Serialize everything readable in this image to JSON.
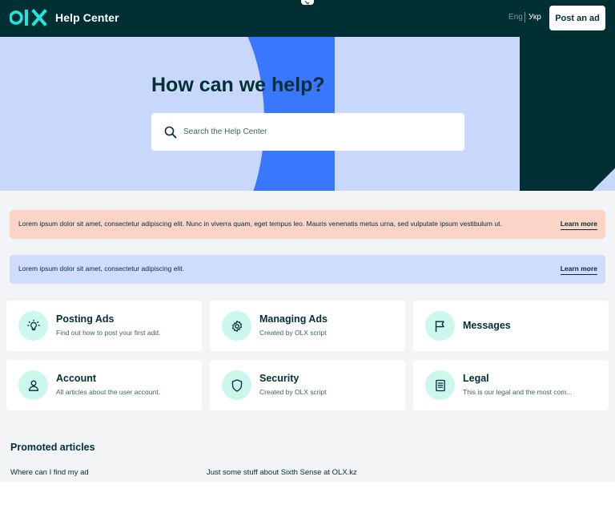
{
  "header": {
    "brand": "olx",
    "title": "Help Center",
    "lang_en": "Eng",
    "lang_uk": "Укр",
    "post_button": "Post an ad"
  },
  "colors": {
    "dark": "#002f34",
    "hero_light": "#c8d8fc",
    "hero_blue": "#3a77ff",
    "accent_teal": "#23e5db",
    "banner_peach": "#fbd4c8",
    "banner_lavender": "#d0dcfc",
    "icon_bg": "#cbf7ee"
  },
  "hero": {
    "title": "How can we help?",
    "search_placeholder": "Search the Help Center"
  },
  "banners": [
    {
      "text": "Lorem ipsum dolor sit amet, consectetur adipiscing elit. Nunc in viverra quam, eget tempus leo. Mauris venenatis metus urna, sed vulputate ipsum vestibulum ut.",
      "link": "Learn more"
    },
    {
      "text": "Lorem ipsum dolor sit amet, consectetur adipiscing elit.",
      "link": "Learn more"
    }
  ],
  "categories": [
    {
      "title": "Posting Ads",
      "subtitle": "Find out how to post your first add.",
      "icon": "lightbulb-icon"
    },
    {
      "title": "Managing Ads",
      "subtitle": "Created by OLX script",
      "icon": "gear-icon"
    },
    {
      "title": "Messages",
      "subtitle": "",
      "icon": "flag-icon"
    },
    {
      "title": "Account",
      "subtitle": "All articles about the user account.",
      "icon": "user-icon"
    },
    {
      "title": "Security",
      "subtitle": "Created by OLX script",
      "icon": "shield-icon"
    },
    {
      "title": "Legal",
      "subtitle": "This is our legal and the most com...",
      "icon": "document-icon"
    }
  ],
  "promoted": {
    "title": "Promoted articles",
    "articles": [
      "Where can I find my ad",
      "Just some stuff about Sixth Sense at OLX.kz"
    ]
  }
}
